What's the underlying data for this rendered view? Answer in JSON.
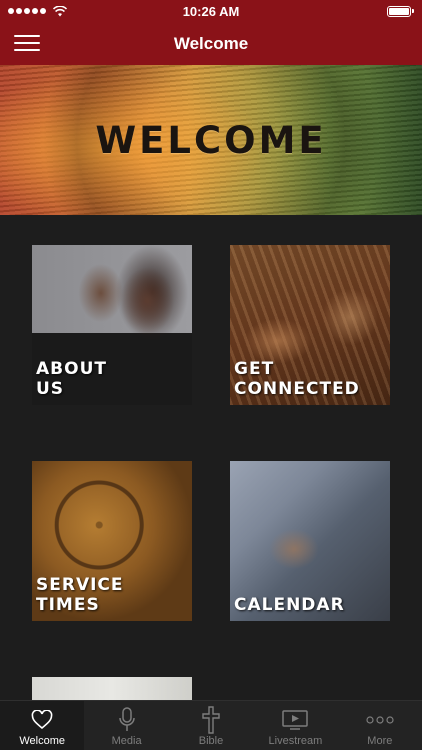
{
  "status_bar": {
    "time": "10:26 AM"
  },
  "nav": {
    "title": "Welcome"
  },
  "hero": {
    "title": "WELCOME"
  },
  "tiles": [
    {
      "label": "ABOUT\nUS"
    },
    {
      "label": "GET\nCONNECTED"
    },
    {
      "label": "SERVICE\nTIMES"
    },
    {
      "label": "CALENDAR"
    }
  ],
  "tab_bar": {
    "tabs": [
      {
        "label": "Welcome",
        "icon": "heart-icon",
        "active": true
      },
      {
        "label": "Media",
        "icon": "microphone-icon",
        "active": false
      },
      {
        "label": "Bible",
        "icon": "cross-icon",
        "active": false
      },
      {
        "label": "Livestream",
        "icon": "play-screen-icon",
        "active": false
      },
      {
        "label": "More",
        "icon": "more-dots-icon",
        "active": false
      }
    ]
  },
  "colors": {
    "brand": "#8a1218",
    "background": "#1d1d1d",
    "tab_bar": "#232323",
    "tab_inactive": "#7d7d7d",
    "tab_active": "#ffffff"
  }
}
